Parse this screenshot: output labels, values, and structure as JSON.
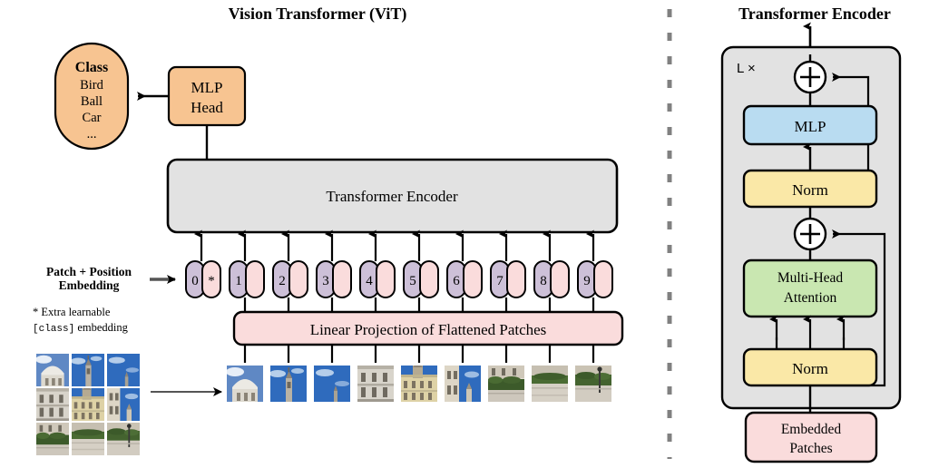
{
  "figure": {
    "left_title": "Vision Transformer (ViT)",
    "right_title": "Transformer Encoder"
  },
  "class_box": {
    "heading": "Class",
    "items": [
      "Bird",
      "Ball",
      "Car",
      "..."
    ]
  },
  "mlp_head": {
    "line1": "MLP",
    "line2": "Head"
  },
  "transformer_encoder_box": {
    "label": "Transformer Encoder"
  },
  "linear_projection": {
    "label": "Linear Projection of Flattened Patches"
  },
  "embedding_annotation": {
    "line1": "Patch + Position",
    "line2": "Embedding",
    "footnote_prefix": "* Extra learnable",
    "footnote_code": "[class]",
    "footnote_suffix": " embedding"
  },
  "tokens": [
    {
      "num": "0",
      "extra": "*"
    },
    {
      "num": "1",
      "extra": ""
    },
    {
      "num": "2",
      "extra": ""
    },
    {
      "num": "3",
      "extra": ""
    },
    {
      "num": "4",
      "extra": ""
    },
    {
      "num": "5",
      "extra": ""
    },
    {
      "num": "6",
      "extra": ""
    },
    {
      "num": "7",
      "extra": ""
    },
    {
      "num": "8",
      "extra": ""
    },
    {
      "num": "9",
      "extra": ""
    }
  ],
  "encoder_detail": {
    "repeat_label": "L ×",
    "mlp_label": "MLP",
    "norm_top_label": "Norm",
    "attention_line1": "Multi-Head",
    "attention_line2": "Attention",
    "norm_bottom_label": "Norm",
    "embedded_patches_line1": "Embedded",
    "embedded_patches_line2": "Patches",
    "add_symbol": "+"
  },
  "colors": {
    "orange": "#f7c491",
    "gray_box": "#e2e2e2",
    "pink": "#fadcdc",
    "purple": "#cdc0d8",
    "blue": "#b9dcf1",
    "yellow": "#fae8a7",
    "green": "#c9e7b1",
    "stroke": "#000000",
    "divider": "#808080",
    "sky": "#2f6bbd",
    "stone": "#cfc8bd",
    "foliage": "#3c5a2a"
  },
  "patch_grid": {
    "rows": 3,
    "cols": 3,
    "description": "source image split into 9 patches"
  },
  "patch_sequence": {
    "count": 9
  }
}
